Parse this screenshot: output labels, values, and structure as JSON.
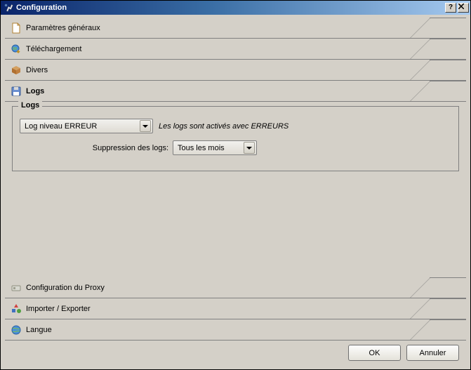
{
  "window": {
    "title": "Configuration"
  },
  "tabs": {
    "general": {
      "label": "Paramètres généraux"
    },
    "download": {
      "label": "Téléchargement"
    },
    "misc": {
      "label": "Divers"
    },
    "logs": {
      "label": "Logs"
    },
    "proxy": {
      "label": "Configuration du Proxy"
    },
    "impexp": {
      "label": "Importer / Exporter"
    },
    "lang": {
      "label": "Langue"
    }
  },
  "logs_panel": {
    "group_title": "Logs",
    "level_combo": {
      "value": "Log niveau ERREUR"
    },
    "status_hint": "Les logs sont activés avec ERREURS",
    "purge_label": "Suppression des logs:",
    "purge_combo": {
      "value": "Tous les mois"
    }
  },
  "buttons": {
    "ok": "OK",
    "cancel": "Annuler"
  }
}
